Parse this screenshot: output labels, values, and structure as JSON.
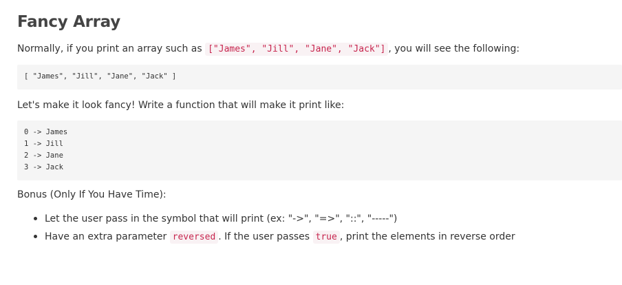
{
  "title": "Fancy Array",
  "intro": {
    "before": "Normally, if you print an array such as ",
    "code": "[\"James\", \"Jill\", \"Jane\", \"Jack\"]",
    "after": ", you will see the following:"
  },
  "output_plain": [
    "[ \"James\", \"Jill\", \"Jane\", \"Jack\" ]"
  ],
  "fancy_prompt": "Let's make it look fancy! Write a function that will make it print like:",
  "output_fancy": [
    "0 -> James",
    "1 -> Jill",
    "2 -> Jane",
    "3 -> Jack"
  ],
  "bonus_heading": "Bonus (Only If You Have Time):",
  "bonus": {
    "item1": "Let the user pass in the symbol that will print (ex: \"->\", \"=>\", \"::\", \"-----\")",
    "item2": {
      "before": "Have an extra parameter ",
      "code1": "reversed",
      "middle": ". If the user passes ",
      "code2": "true",
      "after": ", print the elements in reverse order"
    }
  }
}
